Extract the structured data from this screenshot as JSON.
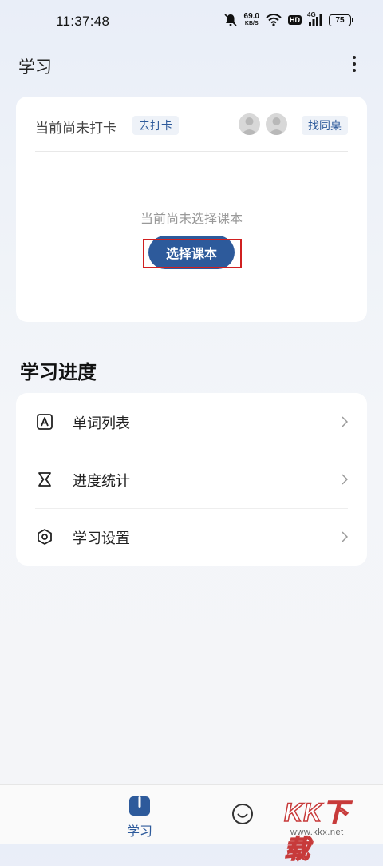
{
  "status_bar": {
    "time": "11:37:48",
    "net_speed_value": "69.0",
    "net_speed_unit": "KB/S",
    "hd_label": "HD",
    "network_label": "4G",
    "battery": "75"
  },
  "header": {
    "title": "学习"
  },
  "checkin": {
    "status_text": "当前尚未打卡",
    "checkin_button": "去打卡",
    "find_desk_button": "找同桌"
  },
  "textbook": {
    "empty_text": "当前尚未选择课本",
    "select_button": "选择课本"
  },
  "progress_section": {
    "title": "学习进度",
    "items": [
      {
        "label": "单词列表",
        "icon": "letter-a-icon"
      },
      {
        "label": "进度统计",
        "icon": "hourglass-icon"
      },
      {
        "label": "学习设置",
        "icon": "hexagon-settings-icon"
      }
    ]
  },
  "bottom_nav": {
    "study_label": "学习"
  },
  "watermark": {
    "text": "KK下载",
    "url": "www.kkx.net"
  },
  "colors": {
    "accent": "#2d5a9b",
    "highlight": "#d02020"
  }
}
